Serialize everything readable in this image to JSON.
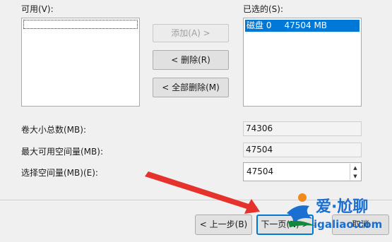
{
  "available": {
    "label": "可用(V):"
  },
  "selected": {
    "label": "已选的(S):",
    "items": [
      {
        "disk": "磁盘 0",
        "size": "47504 MB"
      }
    ]
  },
  "buttons": {
    "add": "添加(A) >",
    "remove": "< 删除(R)",
    "remove_all": "< 全部删除(M)"
  },
  "fields": {
    "total_label": "卷大小总数(MB):",
    "total_value": "74306",
    "max_label": "最大可用空间量(MB):",
    "max_value": "47504",
    "select_label": "选择空间量(MB)(E):",
    "select_value": "47504"
  },
  "footer": {
    "back": "< 上一步(B)",
    "next": "下一页(N) >",
    "cancel": "取消"
  },
  "watermark": {
    "cn": "爱·尬聊",
    "url": "igaliao.com"
  },
  "colors": {
    "selection": "#0078d7",
    "annotation_arrow": "#e5322d",
    "watermark_blue": "#1a6fd0"
  }
}
